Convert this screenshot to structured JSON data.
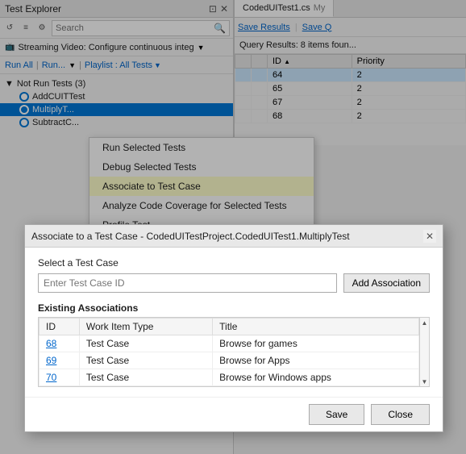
{
  "testExplorer": {
    "title": "Test Explorer",
    "searchPlaceholder": "Search",
    "streamingText": "Streaming Video: Configure continuous integ",
    "runAll": "Run All",
    "run": "Run...",
    "playlist": "Playlist : All Tests",
    "notRunSection": "Not Run Tests (3)",
    "tests": [
      {
        "name": "AddCUITTest",
        "selected": false,
        "highlighted": false
      },
      {
        "name": "MultiplyT...",
        "selected": true,
        "highlighted": false
      },
      {
        "name": "SubtractC...",
        "selected": false,
        "highlighted": false
      }
    ]
  },
  "contextMenu": {
    "items": [
      {
        "label": "Run Selected Tests",
        "highlighted": false
      },
      {
        "label": "Debug Selected Tests",
        "highlighted": false
      },
      {
        "label": "Associate to Test Case",
        "highlighted": true
      },
      {
        "label": "Analyze Code Coverage for Selected Tests",
        "highlighted": false
      },
      {
        "label": "Profile Test...",
        "highlighted": false
      }
    ]
  },
  "codePanel": {
    "tabLabel": "CodedUITest1.cs",
    "saveResults": "Save Results",
    "saveQ": "Save Q",
    "queryResults": "Query Results: 8 items foun...",
    "columns": [
      "ID",
      "Priority"
    ],
    "rows": [
      {
        "id": "64",
        "priority": "2",
        "selected": true
      },
      {
        "id": "65",
        "priority": "2",
        "selected": false
      },
      {
        "id": "67",
        "priority": "2",
        "selected": false
      },
      {
        "id": "68",
        "priority": "2",
        "selected": false
      }
    ]
  },
  "modal": {
    "title": "Associate to a Test Case - CodedUITestProject.CodedUITest1.MultiplyTest",
    "sectionLabel": "Select a Test Case",
    "inputPlaceholder": "Enter Test Case ID",
    "addAssocLabel": "Add Association",
    "existingLabel": "Existing Associations",
    "tableColumns": [
      "ID",
      "Work Item Type",
      "Title"
    ],
    "tableRows": [
      {
        "id": "68",
        "type": "Test Case",
        "title": "Browse for games"
      },
      {
        "id": "69",
        "type": "Test Case",
        "title": "Browse for Apps"
      },
      {
        "id": "70",
        "type": "Test Case",
        "title": "Browse for Windows apps"
      }
    ],
    "saveLabel": "Save",
    "closeLabel": "Close"
  }
}
